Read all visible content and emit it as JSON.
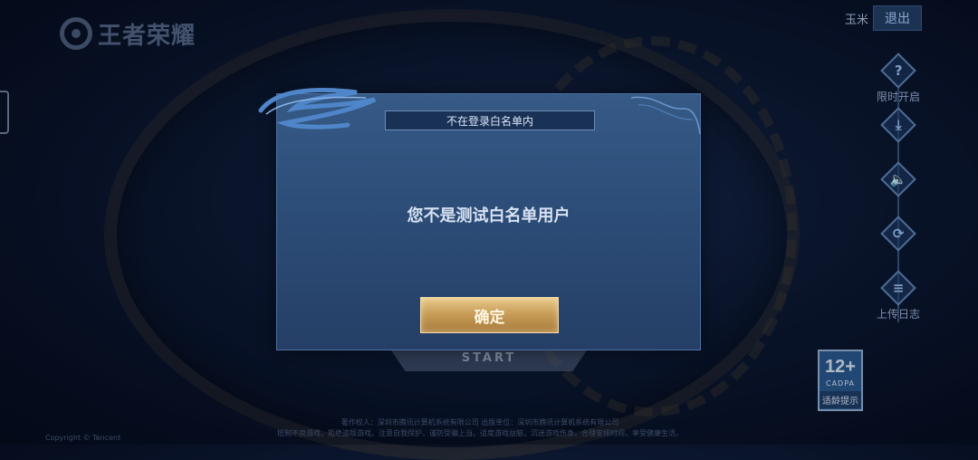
{
  "logo": {
    "text": "王者荣耀"
  },
  "user": {
    "name": "玉米",
    "logout_label": "退出"
  },
  "side_menu": [
    {
      "icon": "question-icon",
      "glyph": "?",
      "label": "限时开启"
    },
    {
      "icon": "download-icon",
      "glyph": "⤓",
      "label": ""
    },
    {
      "icon": "speaker-icon",
      "glyph": "🔈",
      "label": ""
    },
    {
      "icon": "refresh-icon",
      "glyph": "⟳",
      "label": ""
    },
    {
      "icon": "log-icon",
      "glyph": "≡",
      "label": "上传日志"
    }
  ],
  "dialog": {
    "title": "不在登录白名单内",
    "message": "您不是测试白名单用户",
    "confirm_label": "确定"
  },
  "start_button": {
    "label": "START"
  },
  "age_rating": {
    "number": "12+",
    "org": "CADPA",
    "tip": "适龄提示"
  },
  "footer": {
    "line1": "著作权人：深圳市腾讯计算机系统有限公司 出版单位：深圳市腾讯计算机系统有限公司",
    "line2": "抵制不良游戏，拒绝盗版游戏。注意自我保护，谨防受骗上当。适度游戏益脑，沉迷游戏伤身。合理安排时间，享受健康生活。",
    "small": "Copyright © Tencent"
  },
  "colors": {
    "dialog_bg": "#2c4d78",
    "confirm_gold": "#c49a55",
    "title_bar": "#1a3156"
  }
}
